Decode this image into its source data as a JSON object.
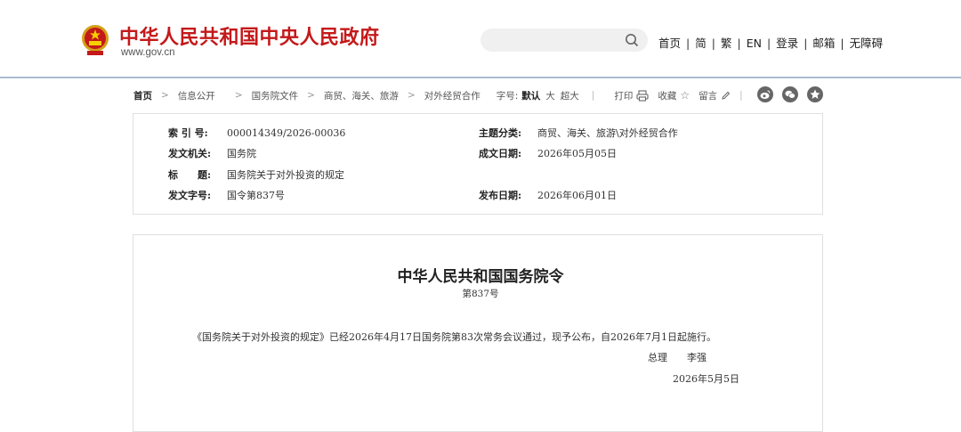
{
  "header": {
    "site_title": "中华人民共和国中央人民政府",
    "site_domain": "www.gov.cn",
    "search": {
      "placeholder": ""
    },
    "top_links": [
      "首页",
      "简",
      "繁",
      "EN",
      "登录",
      "邮箱",
      "无障碍"
    ]
  },
  "breadcrumb": {
    "home": "首页",
    "items": [
      "信息公开",
      "国务院文件",
      "商贸、海关、旅游",
      "对外经贸合作"
    ]
  },
  "toolbar": {
    "font_label": "字号:",
    "font_default": "默认",
    "font_large": "大",
    "font_xlarge": "超大",
    "print": "打印",
    "favorite": "收藏",
    "comment": "留言"
  },
  "social_icons": [
    "weibo-icon",
    "wechat-icon",
    "qzone-icon"
  ],
  "meta": {
    "index_no_label": "索 引 号:",
    "index_no": "000014349/2026-00036",
    "category_label": "主题分类:",
    "category": "商贸、海关、旅游\\对外经贸合作",
    "issuer_label": "发文机关:",
    "issuer": "国务院",
    "written_date_label": "成文日期:",
    "written_date": "2026年05月05日",
    "title_label": "标　　题:",
    "title": "国务院关于对外投资的规定",
    "doc_no_label": "发文字号:",
    "doc_no": "国令第837号",
    "publish_date_label": "发布日期:",
    "publish_date": "2026年06月01日"
  },
  "document": {
    "heading": "中华人民共和国国务院令",
    "number": "第837号",
    "body": "《国务院关于对外投资的规定》已经2026年4月17日国务院第83次常务会议通过，现予公布，自2026年7月1日起施行。",
    "signer_title": "总理",
    "signer_name": "李强",
    "date": "2026年5月5日"
  },
  "colors": {
    "brand_red": "#c4191a",
    "divider": "#a9bcd0"
  }
}
